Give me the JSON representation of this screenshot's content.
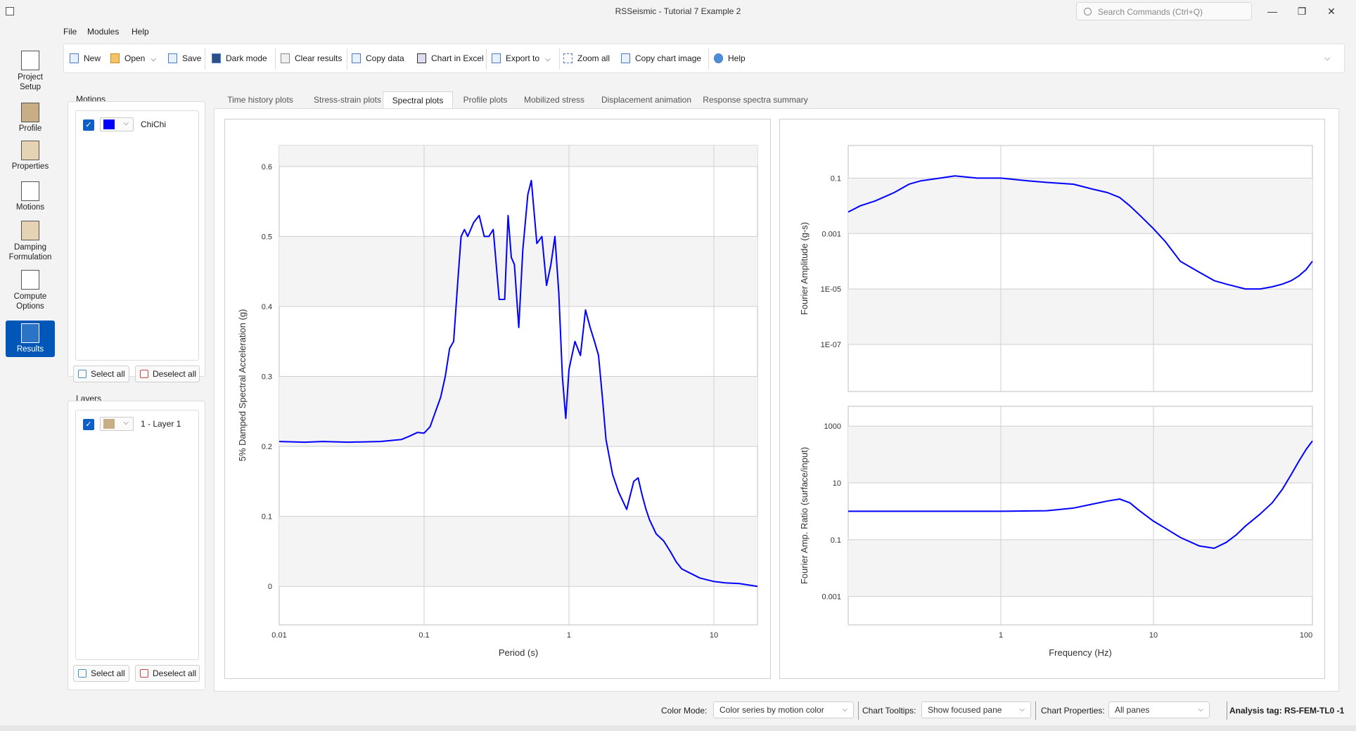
{
  "window": {
    "title": "RSSeismic - Tutorial 7 Example 2",
    "search_placeholder": "Search Commands (Ctrl+Q)",
    "minimize": "—",
    "maximize": "❐",
    "close": "✕"
  },
  "leftnav": {
    "items": [
      {
        "label": "Project Setup",
        "icon": "project-setup-icon"
      },
      {
        "label": "Profile",
        "icon": "profile-icon"
      },
      {
        "label": "Properties",
        "icon": "properties-icon"
      },
      {
        "label": "Motions",
        "icon": "motions-icon"
      },
      {
        "label": "Damping Formulation",
        "icon": "damping-icon"
      },
      {
        "label": "Compute Options",
        "icon": "compute-icon"
      },
      {
        "label": "Results",
        "icon": "results-icon",
        "active": true
      }
    ]
  },
  "menu": {
    "file": "File",
    "modules": "Modules",
    "help": "Help"
  },
  "toolbar": {
    "new": "New",
    "open": "Open",
    "save": "Save",
    "dark_mode": "Dark mode",
    "clear_results": "Clear results",
    "copy_data": "Copy data",
    "chart_in_excel": "Chart in Excel",
    "export_to": "Export to",
    "zoom_all": "Zoom all",
    "copy_chart_image": "Copy chart image",
    "help": "Help"
  },
  "motions_panel": {
    "label": "Motions",
    "items": [
      {
        "name": "ChiChi",
        "color": "#0000ff",
        "checked": true
      }
    ],
    "select_all": "Select all",
    "deselect_all": "Deselect all"
  },
  "layers_panel": {
    "label": "Layers",
    "items": [
      {
        "name": "1 - Layer 1",
        "color": "#c8ad85",
        "checked": true
      }
    ],
    "select_all": "Select all",
    "deselect_all": "Deselect all"
  },
  "tabs": [
    {
      "label": "Time history plots"
    },
    {
      "label": "Stress-strain plots"
    },
    {
      "label": "Spectral plots",
      "active": true
    },
    {
      "label": "Profile plots"
    },
    {
      "label": "Mobilized stress"
    },
    {
      "label": "Displacement animation"
    },
    {
      "label": "Response spectra summary"
    }
  ],
  "status": {
    "color_mode_label": "Color Mode:",
    "color_mode_value": "Color series by motion color",
    "tooltips_label": "Chart Tooltips:",
    "tooltips_value": "Show focused pane",
    "properties_label": "Chart Properties:",
    "properties_value": "All panes",
    "analysis_tag": "Analysis tag: RS-FEM-TL0 -1"
  },
  "colors": {
    "series": "#0000ff",
    "accent": "#0057b7"
  },
  "chart_data": [
    {
      "type": "line",
      "xlabel": "Period (s)",
      "ylabel": "5% Damped Spectral Acceleration (g)",
      "xscale": "log",
      "xlim": [
        0.01,
        20
      ],
      "ylim": [
        -0.055,
        0.63
      ],
      "xticks": [
        "0.01",
        "0.1",
        "1",
        "10"
      ],
      "yticks": [
        "0",
        "0.1",
        "0.2",
        "0.3",
        "0.4",
        "0.5",
        "0.6"
      ],
      "series": [
        {
          "color": "#0000ff",
          "x": [
            0.01,
            0.015,
            0.02,
            0.03,
            0.05,
            0.07,
            0.08,
            0.09,
            0.1,
            0.11,
            0.12,
            0.13,
            0.14,
            0.15,
            0.16,
            0.17,
            0.18,
            0.19,
            0.2,
            0.22,
            0.24,
            0.26,
            0.28,
            0.3,
            0.33,
            0.36,
            0.38,
            0.4,
            0.42,
            0.45,
            0.48,
            0.52,
            0.55,
            0.6,
            0.65,
            0.7,
            0.75,
            0.8,
            0.85,
            0.9,
            0.95,
            1.0,
            1.1,
            1.2,
            1.3,
            1.4,
            1.5,
            1.6,
            1.7,
            1.8,
            2.0,
            2.2,
            2.5,
            2.8,
            3.0,
            3.2,
            3.4,
            3.6,
            4.0,
            4.5,
            5.0,
            5.5,
            6.0,
            7.0,
            8.0,
            10.0,
            12.0,
            15.0,
            20.0
          ],
          "y": [
            0.207,
            0.206,
            0.207,
            0.206,
            0.207,
            0.21,
            0.215,
            0.22,
            0.219,
            0.228,
            0.25,
            0.27,
            0.3,
            0.34,
            0.35,
            0.43,
            0.5,
            0.51,
            0.5,
            0.52,
            0.53,
            0.5,
            0.5,
            0.51,
            0.41,
            0.41,
            0.53,
            0.47,
            0.46,
            0.37,
            0.48,
            0.56,
            0.58,
            0.49,
            0.5,
            0.43,
            0.46,
            0.5,
            0.42,
            0.3,
            0.24,
            0.31,
            0.35,
            0.33,
            0.395,
            0.37,
            0.35,
            0.33,
            0.27,
            0.21,
            0.16,
            0.135,
            0.11,
            0.15,
            0.155,
            0.13,
            0.11,
            0.095,
            0.075,
            0.065,
            0.05,
            0.035,
            0.025,
            0.018,
            0.012,
            0.007,
            0.005,
            0.004,
            0.0
          ]
        }
      ]
    },
    {
      "type": "line",
      "xlabel": "",
      "ylabel": "Fourier Amplitude (g-s)",
      "xscale": "log",
      "yscale": "log",
      "xlim": [
        0.1,
        110
      ],
      "ylim": [
        2e-09,
        1.5
      ],
      "yticks": [
        "0.1",
        "0.001",
        "1E-05",
        "1E-07"
      ],
      "series": [
        {
          "color": "#0000ff",
          "x": [
            0.1,
            0.12,
            0.15,
            0.2,
            0.25,
            0.3,
            0.4,
            0.5,
            0.7,
            1,
            1.5,
            2,
            3,
            4,
            5,
            6,
            7,
            8,
            10,
            12,
            15,
            20,
            25,
            30,
            40,
            50,
            60,
            70,
            80,
            90,
            100,
            110
          ],
          "y": [
            0.006,
            0.01,
            0.015,
            0.03,
            0.06,
            0.08,
            0.1,
            0.12,
            0.1,
            0.1,
            0.08,
            0.07,
            0.06,
            0.04,
            0.03,
            0.02,
            0.01,
            0.005,
            0.0015,
            0.0005,
            0.0001,
            4e-05,
            2e-05,
            1.5e-05,
            1e-05,
            1e-05,
            1.2e-05,
            1.5e-05,
            2e-05,
            3e-05,
            5e-05,
            0.0001
          ]
        }
      ]
    },
    {
      "type": "line",
      "xlabel": "Frequency (Hz)",
      "ylabel": "Fourier Amp. Ratio (surface/input)",
      "xscale": "log",
      "yscale": "log",
      "xlim": [
        0.1,
        110
      ],
      "ylim": [
        0.0001,
        5000
      ],
      "xticks": [
        "1",
        "10",
        "100"
      ],
      "yticks": [
        "1000",
        "10",
        "0.1",
        "0.001"
      ],
      "series": [
        {
          "color": "#0000ff",
          "x": [
            0.1,
            0.2,
            0.5,
            1,
            2,
            3,
            4,
            5,
            6,
            7,
            8,
            10,
            12,
            15,
            20,
            25,
            30,
            35,
            40,
            50,
            60,
            70,
            80,
            90,
            100,
            110
          ],
          "y": [
            1,
            1,
            1,
            1,
            1.05,
            1.3,
            1.8,
            2.3,
            2.7,
            2.0,
            1.1,
            0.45,
            0.25,
            0.12,
            0.06,
            0.05,
            0.08,
            0.15,
            0.3,
            0.8,
            2,
            6,
            20,
            60,
            150,
            300
          ]
        }
      ]
    }
  ]
}
